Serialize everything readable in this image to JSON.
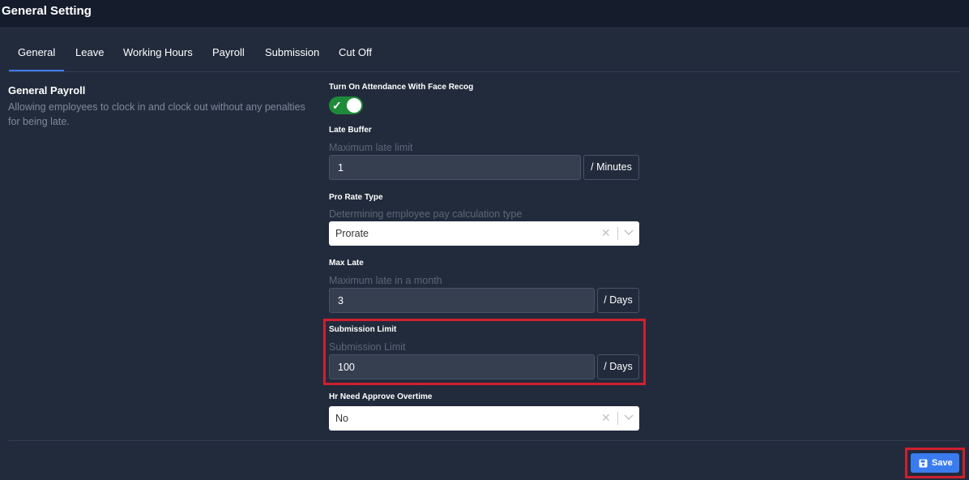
{
  "page": {
    "title": "General Setting"
  },
  "tabs": [
    "General",
    "Leave",
    "Working Hours",
    "Payroll",
    "Submission",
    "Cut Off"
  ],
  "section": {
    "title": "General Payroll",
    "description": "Allowing employees to clock in and clock out without any penalties for being late."
  },
  "face_recog": {
    "label": "Turn On Attendance With Face Recog",
    "enabled": true
  },
  "late_buffer": {
    "label": "Late Buffer",
    "hint": "Maximum late limit",
    "value": "1",
    "unit": "/ Minutes"
  },
  "pro_rate": {
    "label": "Pro Rate Type",
    "hint": "Determining employee pay calculation type",
    "value": "Prorate"
  },
  "max_late": {
    "label": "Max Late",
    "hint": "Maximum late in a month",
    "value": "3",
    "unit": "/ Days"
  },
  "submission_limit": {
    "label": "Submission Limit",
    "hint": "Submission Limit",
    "value": "100",
    "unit": "/ Days"
  },
  "hr_approve": {
    "label": "Hr Need Approve Overtime",
    "value": "No"
  },
  "actions": {
    "save_label": "Save"
  },
  "colors": {
    "accent": "#3a7bf0",
    "toggle_on": "#1f8a3a",
    "highlight": "#d0202e",
    "background": "#151c2c",
    "card": "#222b3c"
  }
}
